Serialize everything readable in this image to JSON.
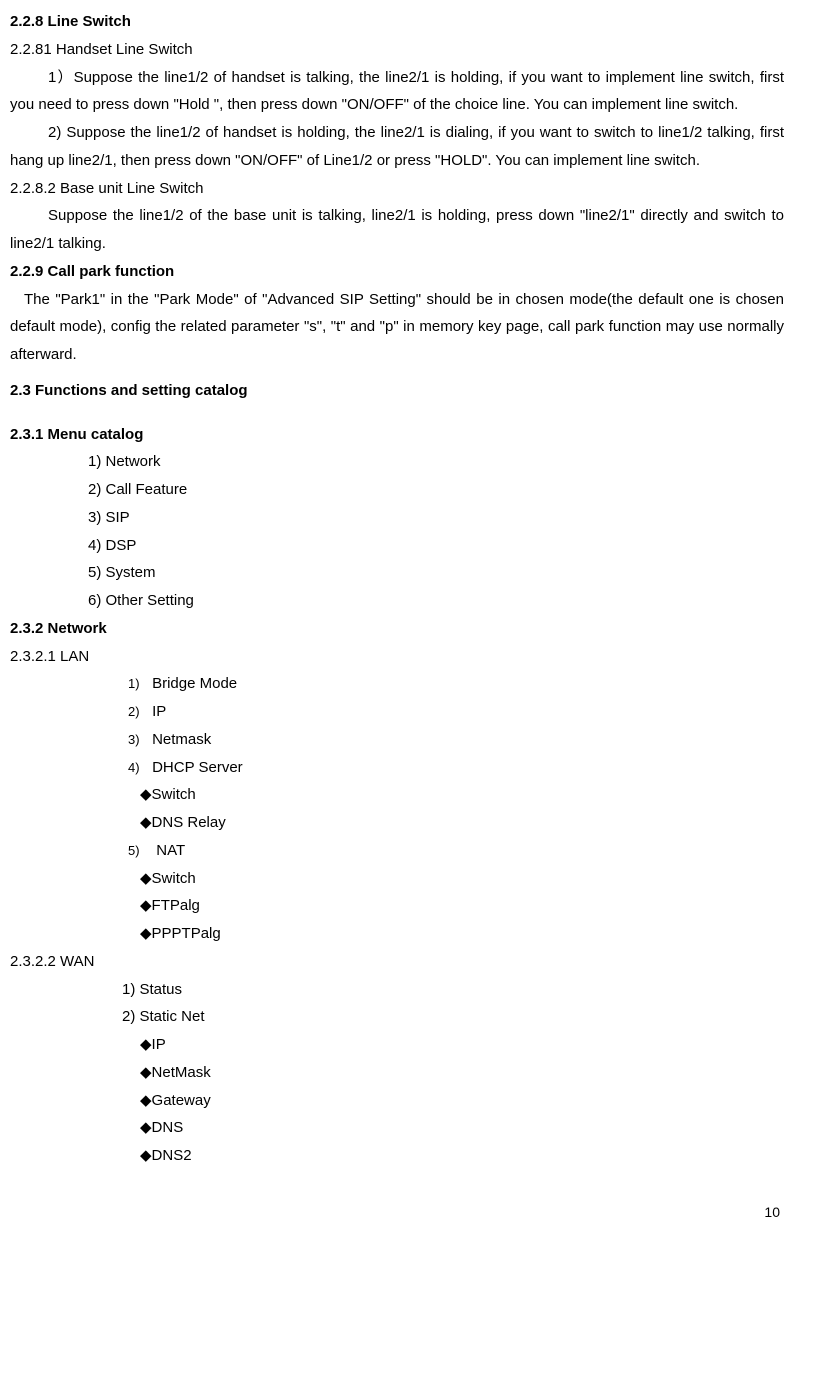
{
  "s228": {
    "heading": "2.2.8 Line Switch",
    "sub1_heading": "2.2.81 Handset Line Switch",
    "sub1_p1": "1）Suppose the line1/2 of handset is talking, the line2/1 is holding, if you want to implement line switch, first you need to press down \"Hold \", then press down \"ON/OFF\" of the choice line. You can implement line switch.",
    "sub1_p2": "2) Suppose the line1/2 of handset is holding, the line2/1 is dialing, if you want to switch to line1/2 talking, first hang up line2/1, then press down \"ON/OFF\" of Line1/2 or press \"HOLD\". You can implement line switch.",
    "sub2_heading": "2.2.8.2 Base unit Line Switch",
    "sub2_p1": "Suppose the line1/2 of the base unit is talking, line2/1 is holding, press down \"line2/1\" directly and switch to line2/1 talking."
  },
  "s229": {
    "heading": "2.2.9 Call park function",
    "p1": "The \"Park1\" in the \"Park Mode\" of \"Advanced SIP Setting\" should be in chosen mode(the default one is chosen default mode), config the related parameter \"s\", \"t\" and \"p\" in memory key page, call park function may use normally afterward."
  },
  "s23": {
    "heading": "2.3 Functions and setting catalog"
  },
  "s231": {
    "heading": "2.3.1 Menu catalog",
    "items": {
      "i1": "1) Network",
      "i2": "2) Call Feature",
      "i3": "3) SIP",
      "i4": "4) DSP",
      "i5": "5) System",
      "i6": "6) Other Setting"
    }
  },
  "s232": {
    "heading": "2.3.2 Network",
    "lan": {
      "heading": "2.3.2.1 LAN",
      "num1": "1)",
      "item1": "Bridge Mode",
      "num2": "2)",
      "item2": "IP",
      "num3": "3)",
      "item3": "Netmask",
      "num4": "4)",
      "item4": "DHCP Server",
      "sub4a": "◆Switch",
      "sub4b": "◆DNS Relay",
      "num5": "5)",
      "item5": "NAT",
      "sub5a": "◆Switch",
      "sub5b": "◆FTPalg",
      "sub5c": "◆PPPTPalg"
    },
    "wan": {
      "heading": "2.3.2.2 WAN",
      "item1": "1)   Status",
      "item2": "2)   Static Net",
      "sub2a": "◆IP",
      "sub2b": "◆NetMask",
      "sub2c": "◆Gateway",
      "sub2d": "◆DNS",
      "sub2e": "◆DNS2"
    }
  },
  "page_number": "10"
}
